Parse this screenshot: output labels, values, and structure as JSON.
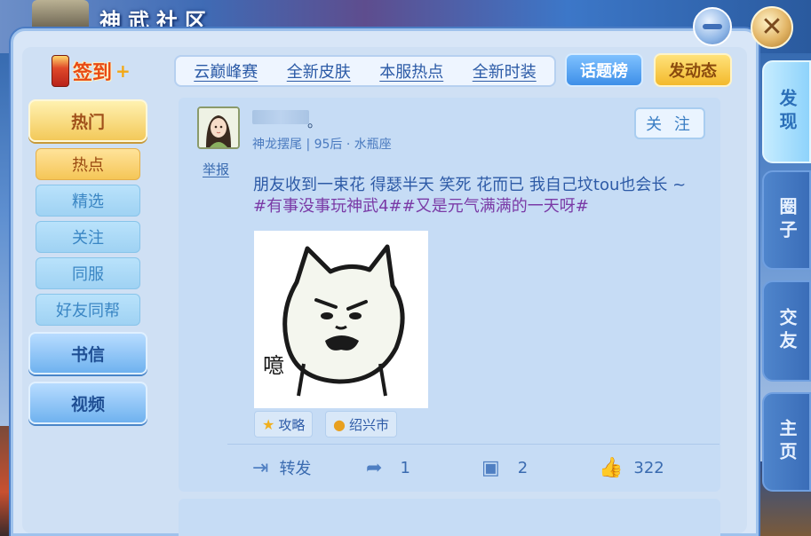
{
  "window": {
    "title": "神武社区"
  },
  "controls": {
    "minimize_icon": "minus-icon",
    "close_icon": "close-icon",
    "close_glyph": "✕"
  },
  "signin": {
    "label": "签到",
    "plus": "+"
  },
  "topbar": {
    "tabs": [
      "云巅峰赛",
      "全新皮肤",
      "本服热点",
      "全新时装"
    ]
  },
  "buttons": {
    "topics": "话题榜",
    "post": "发动态"
  },
  "nav": {
    "main": [
      {
        "label": "热门",
        "active": true
      },
      {
        "label": "书信",
        "active": false
      },
      {
        "label": "视频",
        "active": false
      }
    ],
    "sub": [
      {
        "label": "热点",
        "active": true
      },
      {
        "label": "精选",
        "active": false
      },
      {
        "label": "关注",
        "active": false
      },
      {
        "label": "同服",
        "active": false
      },
      {
        "label": "好友同帮",
        "active": false
      }
    ]
  },
  "side_tabs": [
    {
      "label": "发现",
      "active": true
    },
    {
      "label": "圈子",
      "active": false
    },
    {
      "label": "交友",
      "active": false
    },
    {
      "label": "主页",
      "active": false
    }
  ],
  "post": {
    "username_suffix": "。",
    "user_info": "神龙摆尾 | 95后 · 水瓶座",
    "follow_label": "关 注",
    "report_label": "举报",
    "text": "朋友收到一束花  得瑟半天  笑死  花而已  我自己坟tou也会长 ~ ",
    "tags": "#有事没事玩神武4##又是元气满满的一天呀#",
    "image_caption": "噫",
    "chips": [
      {
        "icon": "star-icon",
        "label": "攻略"
      },
      {
        "icon": "location-pin-icon",
        "label": "绍兴市"
      }
    ],
    "actions": {
      "repost_label": "转发",
      "share_count": "1",
      "comment_count": "2",
      "like_count": "322"
    }
  }
}
